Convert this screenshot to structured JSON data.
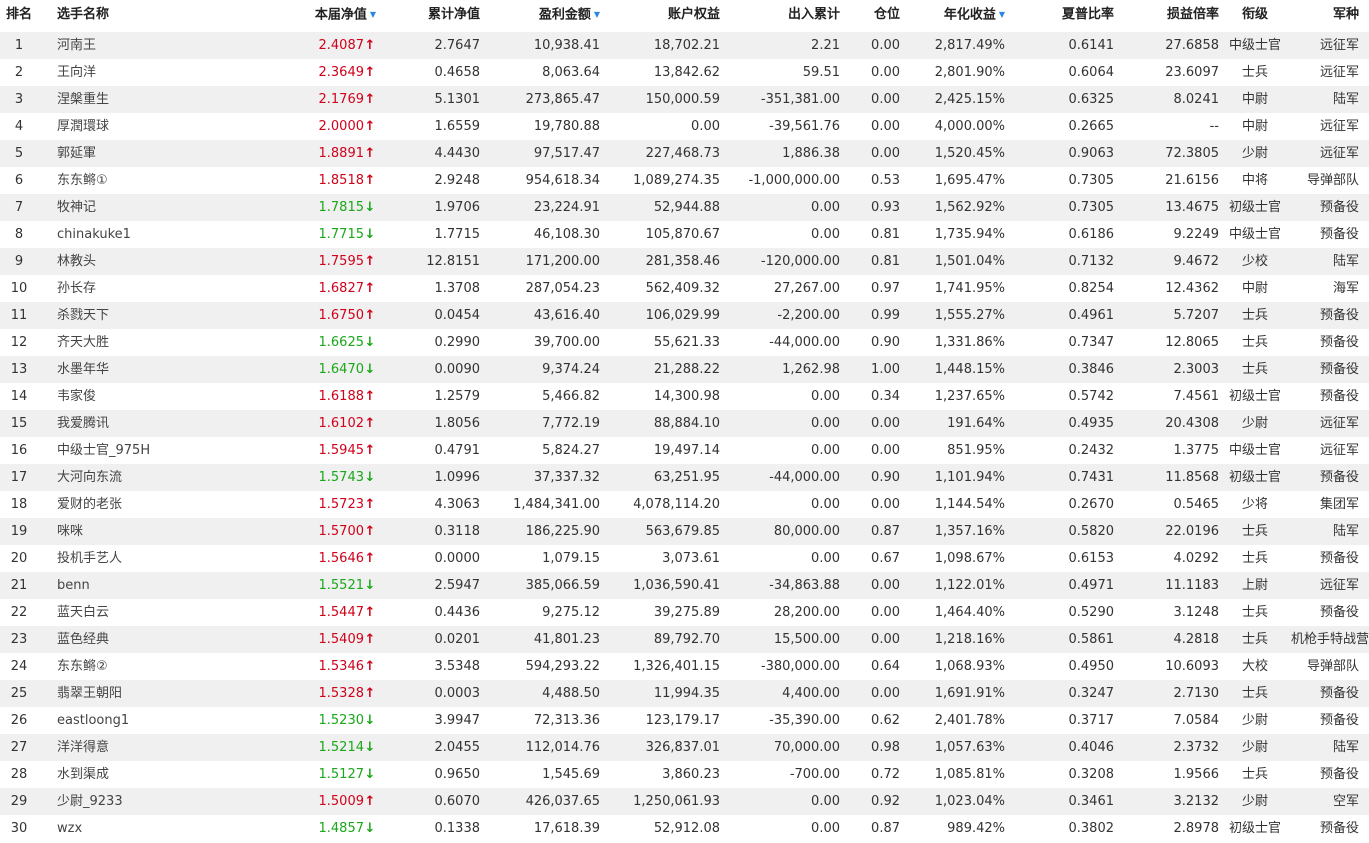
{
  "headers": {
    "rank": "排名",
    "name": "选手名称",
    "nav": "本届净值",
    "cum_nav": "累计净值",
    "profit": "盈利金额",
    "equity": "账户权益",
    "flow": "出入累计",
    "position": "仓位",
    "annual": "年化收益",
    "sharpe": "夏普比率",
    "pl_ratio": "损益倍率",
    "title": "衔级",
    "branch": "军种"
  },
  "sort_icon": "sort-desc-icon",
  "colors": {
    "up": "#d0021b",
    "down": "#1aa81a",
    "sort": "#2a8ae0",
    "stripe": "#f0f0f0"
  },
  "rows": [
    {
      "rank": "1",
      "name": "河南王",
      "nav": "2.4087",
      "dir": "up",
      "cum_nav": "2.7647",
      "profit": "10,938.41",
      "equity": "18,702.21",
      "flow": "2.21",
      "position": "0.00",
      "annual": "2,817.49%",
      "sharpe": "0.6141",
      "pl_ratio": "27.6858",
      "title": "中级士官",
      "branch": "远征军"
    },
    {
      "rank": "2",
      "name": "王向洋",
      "nav": "2.3649",
      "dir": "up",
      "cum_nav": "0.4658",
      "profit": "8,063.64",
      "equity": "13,842.62",
      "flow": "59.51",
      "position": "0.00",
      "annual": "2,801.90%",
      "sharpe": "0.6064",
      "pl_ratio": "23.6097",
      "title": "士兵",
      "branch": "远征军"
    },
    {
      "rank": "3",
      "name": "涅槃重生",
      "nav": "2.1769",
      "dir": "up",
      "cum_nav": "5.1301",
      "profit": "273,865.47",
      "equity": "150,000.59",
      "flow": "-351,381.00",
      "position": "0.00",
      "annual": "2,425.15%",
      "sharpe": "0.6325",
      "pl_ratio": "8.0241",
      "title": "中尉",
      "branch": "陆军"
    },
    {
      "rank": "4",
      "name": "厚潤環球",
      "nav": "2.0000",
      "dir": "up",
      "cum_nav": "1.6559",
      "profit": "19,780.88",
      "equity": "0.00",
      "flow": "-39,561.76",
      "position": "0.00",
      "annual": "4,000.00%",
      "sharpe": "0.2665",
      "pl_ratio": "--",
      "title": "中尉",
      "branch": "远征军"
    },
    {
      "rank": "5",
      "name": "郭延軍",
      "nav": "1.8891",
      "dir": "up",
      "cum_nav": "4.4430",
      "profit": "97,517.47",
      "equity": "227,468.73",
      "flow": "1,886.38",
      "position": "0.00",
      "annual": "1,520.45%",
      "sharpe": "0.9063",
      "pl_ratio": "72.3805",
      "title": "少尉",
      "branch": "远征军"
    },
    {
      "rank": "6",
      "name": "东东鳉①",
      "nav": "1.8518",
      "dir": "up",
      "cum_nav": "2.9248",
      "profit": "954,618.34",
      "equity": "1,089,274.35",
      "flow": "-1,000,000.00",
      "position": "0.53",
      "annual": "1,695.47%",
      "sharpe": "0.7305",
      "pl_ratio": "21.6156",
      "title": "中将",
      "branch": "导弹部队"
    },
    {
      "rank": "7",
      "name": "牧神记",
      "nav": "1.7815",
      "dir": "down",
      "cum_nav": "1.9706",
      "profit": "23,224.91",
      "equity": "52,944.88",
      "flow": "0.00",
      "position": "0.93",
      "annual": "1,562.92%",
      "sharpe": "0.7305",
      "pl_ratio": "13.4675",
      "title": "初级士官",
      "branch": "预备役"
    },
    {
      "rank": "8",
      "name": "chinakuke1",
      "nav": "1.7715",
      "dir": "down",
      "cum_nav": "1.7715",
      "profit": "46,108.30",
      "equity": "105,870.67",
      "flow": "0.00",
      "position": "0.81",
      "annual": "1,735.94%",
      "sharpe": "0.6186",
      "pl_ratio": "9.2249",
      "title": "中级士官",
      "branch": "预备役"
    },
    {
      "rank": "9",
      "name": "林教头",
      "nav": "1.7595",
      "dir": "up",
      "cum_nav": "12.8151",
      "profit": "171,200.00",
      "equity": "281,358.46",
      "flow": "-120,000.00",
      "position": "0.81",
      "annual": "1,501.04%",
      "sharpe": "0.7132",
      "pl_ratio": "9.4672",
      "title": "少校",
      "branch": "陆军"
    },
    {
      "rank": "10",
      "name": "孙长存",
      "nav": "1.6827",
      "dir": "up",
      "cum_nav": "1.3708",
      "profit": "287,054.23",
      "equity": "562,409.32",
      "flow": "27,267.00",
      "position": "0.97",
      "annual": "1,741.95%",
      "sharpe": "0.8254",
      "pl_ratio": "12.4362",
      "title": "中尉",
      "branch": "海军"
    },
    {
      "rank": "11",
      "name": "杀戮天下",
      "nav": "1.6750",
      "dir": "up",
      "cum_nav": "0.0454",
      "profit": "43,616.40",
      "equity": "106,029.99",
      "flow": "-2,200.00",
      "position": "0.99",
      "annual": "1,555.27%",
      "sharpe": "0.4961",
      "pl_ratio": "5.7207",
      "title": "士兵",
      "branch": "预备役"
    },
    {
      "rank": "12",
      "name": "齐天大胜",
      "nav": "1.6625",
      "dir": "down",
      "cum_nav": "0.2990",
      "profit": "39,700.00",
      "equity": "55,621.33",
      "flow": "-44,000.00",
      "position": "0.90",
      "annual": "1,331.86%",
      "sharpe": "0.7347",
      "pl_ratio": "12.8065",
      "title": "士兵",
      "branch": "预备役"
    },
    {
      "rank": "13",
      "name": "水墨年华",
      "nav": "1.6470",
      "dir": "down",
      "cum_nav": "0.0090",
      "profit": "9,374.24",
      "equity": "21,288.22",
      "flow": "1,262.98",
      "position": "1.00",
      "annual": "1,448.15%",
      "sharpe": "0.3846",
      "pl_ratio": "2.3003",
      "title": "士兵",
      "branch": "预备役"
    },
    {
      "rank": "14",
      "name": "韦家俊",
      "nav": "1.6188",
      "dir": "up",
      "cum_nav": "1.2579",
      "profit": "5,466.82",
      "equity": "14,300.98",
      "flow": "0.00",
      "position": "0.34",
      "annual": "1,237.65%",
      "sharpe": "0.5742",
      "pl_ratio": "7.4561",
      "title": "初级士官",
      "branch": "预备役"
    },
    {
      "rank": "15",
      "name": "我爱腾讯",
      "nav": "1.6102",
      "dir": "up",
      "cum_nav": "1.8056",
      "profit": "7,772.19",
      "equity": "88,884.10",
      "flow": "0.00",
      "position": "0.00",
      "annual": "191.64%",
      "sharpe": "0.4935",
      "pl_ratio": "20.4308",
      "title": "少尉",
      "branch": "远征军"
    },
    {
      "rank": "16",
      "name": "中级士官_975H",
      "nav": "1.5945",
      "dir": "up",
      "cum_nav": "0.4791",
      "profit": "5,824.27",
      "equity": "19,497.14",
      "flow": "0.00",
      "position": "0.00",
      "annual": "851.95%",
      "sharpe": "0.2432",
      "pl_ratio": "1.3775",
      "title": "中级士官",
      "branch": "远征军"
    },
    {
      "rank": "17",
      "name": "大河向东流",
      "nav": "1.5743",
      "dir": "down",
      "cum_nav": "1.0996",
      "profit": "37,337.32",
      "equity": "63,251.95",
      "flow": "-44,000.00",
      "position": "0.90",
      "annual": "1,101.94%",
      "sharpe": "0.7431",
      "pl_ratio": "11.8568",
      "title": "初级士官",
      "branch": "预备役"
    },
    {
      "rank": "18",
      "name": "爱财的老张",
      "nav": "1.5723",
      "dir": "up",
      "cum_nav": "4.3063",
      "profit": "1,484,341.00",
      "equity": "4,078,114.20",
      "flow": "0.00",
      "position": "0.00",
      "annual": "1,144.54%",
      "sharpe": "0.2670",
      "pl_ratio": "0.5465",
      "title": "少将",
      "branch": "集团军"
    },
    {
      "rank": "19",
      "name": "咪咪",
      "nav": "1.5700",
      "dir": "up",
      "cum_nav": "0.3118",
      "profit": "186,225.90",
      "equity": "563,679.85",
      "flow": "80,000.00",
      "position": "0.87",
      "annual": "1,357.16%",
      "sharpe": "0.5820",
      "pl_ratio": "22.0196",
      "title": "士兵",
      "branch": "陆军"
    },
    {
      "rank": "20",
      "name": "投机手艺人",
      "nav": "1.5646",
      "dir": "up",
      "cum_nav": "0.0000",
      "profit": "1,079.15",
      "equity": "3,073.61",
      "flow": "0.00",
      "position": "0.67",
      "annual": "1,098.67%",
      "sharpe": "0.6153",
      "pl_ratio": "4.0292",
      "title": "士兵",
      "branch": "预备役"
    },
    {
      "rank": "21",
      "name": "benn",
      "nav": "1.5521",
      "dir": "down",
      "cum_nav": "2.5947",
      "profit": "385,066.59",
      "equity": "1,036,590.41",
      "flow": "-34,863.88",
      "position": "0.00",
      "annual": "1,122.01%",
      "sharpe": "0.4971",
      "pl_ratio": "11.1183",
      "title": "上尉",
      "branch": "远征军"
    },
    {
      "rank": "22",
      "name": "蓝天白云",
      "nav": "1.5447",
      "dir": "up",
      "cum_nav": "0.4436",
      "profit": "9,275.12",
      "equity": "39,275.89",
      "flow": "28,200.00",
      "position": "0.00",
      "annual": "1,464.40%",
      "sharpe": "0.5290",
      "pl_ratio": "3.1248",
      "title": "士兵",
      "branch": "预备役"
    },
    {
      "rank": "23",
      "name": "蓝色经典",
      "nav": "1.5409",
      "dir": "up",
      "cum_nav": "0.0201",
      "profit": "41,801.23",
      "equity": "89,792.70",
      "flow": "15,500.00",
      "position": "0.00",
      "annual": "1,218.16%",
      "sharpe": "0.5861",
      "pl_ratio": "4.2818",
      "title": "士兵",
      "branch": "机枪手特战营"
    },
    {
      "rank": "24",
      "name": "东东鳉②",
      "nav": "1.5346",
      "dir": "up",
      "cum_nav": "3.5348",
      "profit": "594,293.22",
      "equity": "1,326,401.15",
      "flow": "-380,000.00",
      "position": "0.64",
      "annual": "1,068.93%",
      "sharpe": "0.4950",
      "pl_ratio": "10.6093",
      "title": "大校",
      "branch": "导弹部队"
    },
    {
      "rank": "25",
      "name": "翡翠王朝阳",
      "nav": "1.5328",
      "dir": "up",
      "cum_nav": "0.0003",
      "profit": "4,488.50",
      "equity": "11,994.35",
      "flow": "4,400.00",
      "position": "0.00",
      "annual": "1,691.91%",
      "sharpe": "0.3247",
      "pl_ratio": "2.7130",
      "title": "士兵",
      "branch": "预备役"
    },
    {
      "rank": "26",
      "name": "eastloong1",
      "nav": "1.5230",
      "dir": "down",
      "cum_nav": "3.9947",
      "profit": "72,313.36",
      "equity": "123,179.17",
      "flow": "-35,390.00",
      "position": "0.62",
      "annual": "2,401.78%",
      "sharpe": "0.3717",
      "pl_ratio": "7.0584",
      "title": "少尉",
      "branch": "预备役"
    },
    {
      "rank": "27",
      "name": "洋洋得意",
      "nav": "1.5214",
      "dir": "down",
      "cum_nav": "2.0455",
      "profit": "112,014.76",
      "equity": "326,837.01",
      "flow": "70,000.00",
      "position": "0.98",
      "annual": "1,057.63%",
      "sharpe": "0.4046",
      "pl_ratio": "2.3732",
      "title": "少尉",
      "branch": "陆军"
    },
    {
      "rank": "28",
      "name": "水到渠成",
      "nav": "1.5127",
      "dir": "down",
      "cum_nav": "0.9650",
      "profit": "1,545.69",
      "equity": "3,860.23",
      "flow": "-700.00",
      "position": "0.72",
      "annual": "1,085.81%",
      "sharpe": "0.3208",
      "pl_ratio": "1.9566",
      "title": "士兵",
      "branch": "预备役"
    },
    {
      "rank": "29",
      "name": "少尉_9233",
      "nav": "1.5009",
      "dir": "up",
      "cum_nav": "0.6070",
      "profit": "426,037.65",
      "equity": "1,250,061.93",
      "flow": "0.00",
      "position": "0.92",
      "annual": "1,023.04%",
      "sharpe": "0.3461",
      "pl_ratio": "3.2132",
      "title": "少尉",
      "branch": "空军"
    },
    {
      "rank": "30",
      "name": "wzx",
      "nav": "1.4857",
      "dir": "down",
      "cum_nav": "0.1338",
      "profit": "17,618.39",
      "equity": "52,912.08",
      "flow": "0.00",
      "position": "0.87",
      "annual": "989.42%",
      "sharpe": "0.3802",
      "pl_ratio": "2.8978",
      "title": "初级士官",
      "branch": "预备役"
    }
  ]
}
